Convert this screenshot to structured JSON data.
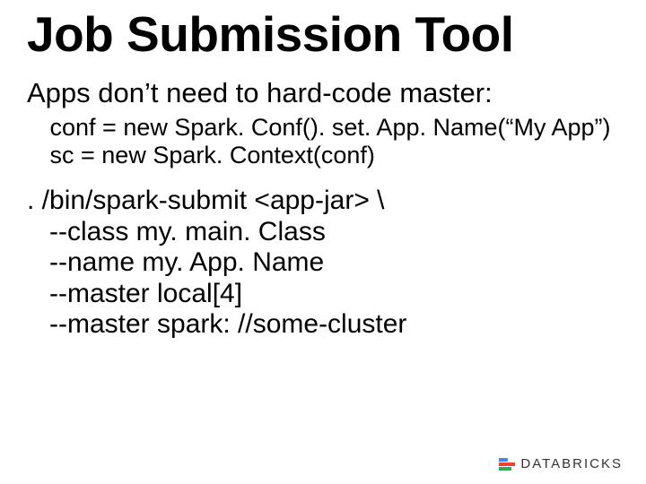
{
  "title": "Job Submission Tool",
  "subtitle": "Apps don’t need to hard-code master:",
  "code": " conf = new Spark. Conf(). set. App. Name(“My App”)\n sc = new Spark. Context(conf)",
  "cmd": ". /bin/spark-submit <app-jar> \\\n   --class my. main. Class\n   --name my. App. Name\n   --master local[4]\n   --master spark: //some-cluster",
  "brand": "DATABRICKS"
}
